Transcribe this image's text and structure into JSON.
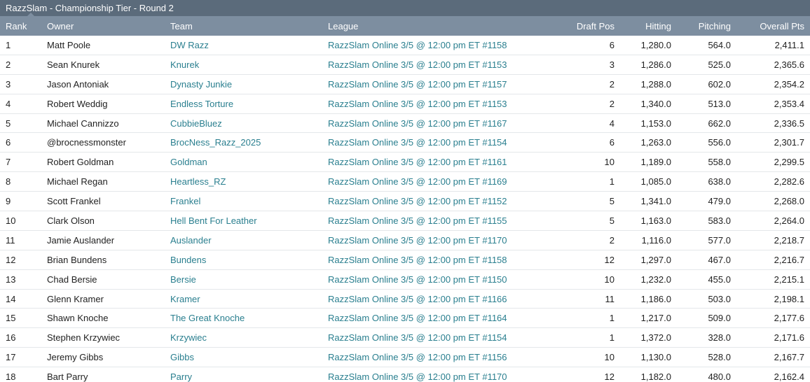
{
  "title": "RazzSlam - Championship Tier - Round 2",
  "columns": {
    "rank": "Rank",
    "owner": "Owner",
    "team": "Team",
    "league": "League",
    "draft_pos": "Draft Pos",
    "hitting": "Hitting",
    "pitching": "Pitching",
    "overall": "Overall Pts"
  },
  "colors": {
    "header_dark": "#5b6b7b",
    "header_light": "#7d8ea0",
    "link": "#2a7f8f"
  },
  "rows": [
    {
      "rank": "1",
      "owner": "Matt Poole",
      "team": "DW Razz",
      "league": "RazzSlam Online 3/5 @ 12:00 pm ET #1158",
      "draft_pos": "6",
      "hitting": "1,280.0",
      "pitching": "564.0",
      "overall": "2,411.1"
    },
    {
      "rank": "2",
      "owner": "Sean Knurek",
      "team": "Knurek",
      "league": "RazzSlam Online 3/5 @ 12:00 pm ET #1153",
      "draft_pos": "3",
      "hitting": "1,286.0",
      "pitching": "525.0",
      "overall": "2,365.6"
    },
    {
      "rank": "3",
      "owner": "Jason Antoniak",
      "team": "Dynasty Junkie",
      "league": "RazzSlam Online 3/5 @ 12:00 pm ET #1157",
      "draft_pos": "2",
      "hitting": "1,288.0",
      "pitching": "602.0",
      "overall": "2,354.2"
    },
    {
      "rank": "4",
      "owner": "Robert Weddig",
      "team": "Endless Torture",
      "league": "RazzSlam Online 3/5 @ 12:00 pm ET #1153",
      "draft_pos": "2",
      "hitting": "1,340.0",
      "pitching": "513.0",
      "overall": "2,353.4"
    },
    {
      "rank": "5",
      "owner": "Michael Cannizzo",
      "team": "CubbieBluez",
      "league": "RazzSlam Online 3/5 @ 12:00 pm ET #1167",
      "draft_pos": "4",
      "hitting": "1,153.0",
      "pitching": "662.0",
      "overall": "2,336.5"
    },
    {
      "rank": "6",
      "owner": "@brocnessmonster",
      "team": "BrocNess_Razz_2025",
      "league": "RazzSlam Online 3/5 @ 12:00 pm ET #1154",
      "draft_pos": "6",
      "hitting": "1,263.0",
      "pitching": "556.0",
      "overall": "2,301.7"
    },
    {
      "rank": "7",
      "owner": "Robert Goldman",
      "team": "Goldman",
      "league": "RazzSlam Online 3/5 @ 12:00 pm ET #1161",
      "draft_pos": "10",
      "hitting": "1,189.0",
      "pitching": "558.0",
      "overall": "2,299.5"
    },
    {
      "rank": "8",
      "owner": "Michael Regan",
      "team": "Heartless_RZ",
      "league": "RazzSlam Online 3/5 @ 12:00 pm ET #1169",
      "draft_pos": "1",
      "hitting": "1,085.0",
      "pitching": "638.0",
      "overall": "2,282.6"
    },
    {
      "rank": "9",
      "owner": "Scott Frankel",
      "team": "Frankel",
      "league": "RazzSlam Online 3/5 @ 12:00 pm ET #1152",
      "draft_pos": "5",
      "hitting": "1,341.0",
      "pitching": "479.0",
      "overall": "2,268.0"
    },
    {
      "rank": "10",
      "owner": "Clark Olson",
      "team": "Hell Bent For Leather",
      "league": "RazzSlam Online 3/5 @ 12:00 pm ET #1155",
      "draft_pos": "5",
      "hitting": "1,163.0",
      "pitching": "583.0",
      "overall": "2,264.0"
    },
    {
      "rank": "11",
      "owner": "Jamie Auslander",
      "team": "Auslander",
      "league": "RazzSlam Online 3/5 @ 12:00 pm ET #1170",
      "draft_pos": "2",
      "hitting": "1,116.0",
      "pitching": "577.0",
      "overall": "2,218.7"
    },
    {
      "rank": "12",
      "owner": "Brian Bundens",
      "team": "Bundens",
      "league": "RazzSlam Online 3/5 @ 12:00 pm ET #1158",
      "draft_pos": "12",
      "hitting": "1,297.0",
      "pitching": "467.0",
      "overall": "2,216.7"
    },
    {
      "rank": "13",
      "owner": "Chad Bersie",
      "team": "Bersie",
      "league": "RazzSlam Online 3/5 @ 12:00 pm ET #1150",
      "draft_pos": "10",
      "hitting": "1,232.0",
      "pitching": "455.0",
      "overall": "2,215.1"
    },
    {
      "rank": "14",
      "owner": "Glenn Kramer",
      "team": "Kramer",
      "league": "RazzSlam Online 3/5 @ 12:00 pm ET #1166",
      "draft_pos": "11",
      "hitting": "1,186.0",
      "pitching": "503.0",
      "overall": "2,198.1"
    },
    {
      "rank": "15",
      "owner": "Shawn Knoche",
      "team": "The Great Knoche",
      "league": "RazzSlam Online 3/5 @ 12:00 pm ET #1164",
      "draft_pos": "1",
      "hitting": "1,217.0",
      "pitching": "509.0",
      "overall": "2,177.6"
    },
    {
      "rank": "16",
      "owner": "Stephen Krzywiec",
      "team": "Krzywiec",
      "league": "RazzSlam Online 3/5 @ 12:00 pm ET #1154",
      "draft_pos": "1",
      "hitting": "1,372.0",
      "pitching": "328.0",
      "overall": "2,171.6"
    },
    {
      "rank": "17",
      "owner": "Jeremy Gibbs",
      "team": "Gibbs",
      "league": "RazzSlam Online 3/5 @ 12:00 pm ET #1156",
      "draft_pos": "10",
      "hitting": "1,130.0",
      "pitching": "528.0",
      "overall": "2,167.7"
    },
    {
      "rank": "18",
      "owner": "Bart Parry",
      "team": "Parry",
      "league": "RazzSlam Online 3/5 @ 12:00 pm ET #1170",
      "draft_pos": "12",
      "hitting": "1,182.0",
      "pitching": "480.0",
      "overall": "2,162.4"
    }
  ]
}
